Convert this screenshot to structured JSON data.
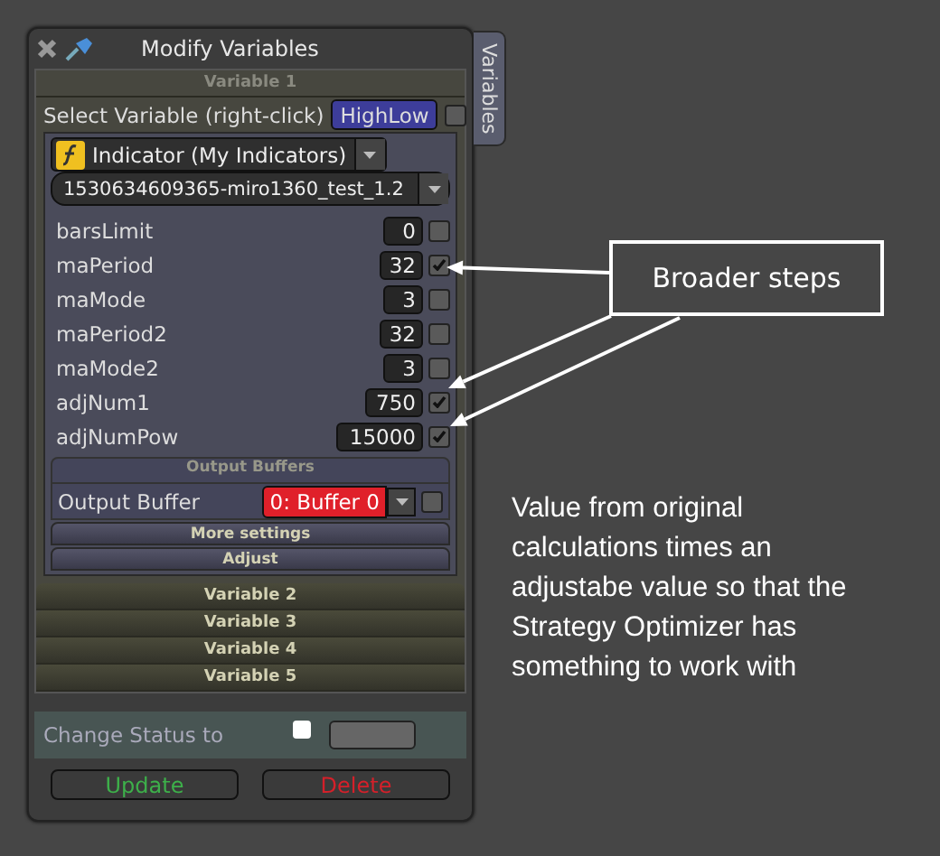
{
  "window": {
    "title": "Modify Variables",
    "side_tab": "Variables"
  },
  "sections": [
    {
      "title": "Variable 1",
      "expanded": true
    },
    {
      "title": "Variable 2",
      "expanded": false
    },
    {
      "title": "Variable 3",
      "expanded": false
    },
    {
      "title": "Variable 4",
      "expanded": false
    },
    {
      "title": "Variable 5",
      "expanded": false
    }
  ],
  "editor": {
    "select_label": "Select Variable (right-click)",
    "variable_button": "HighLow",
    "variable_checked": false,
    "indicator_dropdown": "Indicator (My Indicators)",
    "file_dropdown": "1530634609365-miro1360_test_1.2",
    "params": [
      {
        "name": "barsLimit",
        "value": "0",
        "checked": false
      },
      {
        "name": "maPeriod",
        "value": "32",
        "checked": true
      },
      {
        "name": "maMode",
        "value": "3",
        "checked": false
      },
      {
        "name": "maPeriod2",
        "value": "32",
        "checked": false
      },
      {
        "name": "maMode2",
        "value": "3",
        "checked": false
      },
      {
        "name": "adjNum1",
        "value": "750",
        "checked": true
      },
      {
        "name": "adjNumPow",
        "value": "15000",
        "checked": true
      }
    ],
    "output_buffers": {
      "title": "Output Buffers",
      "label": "Output Buffer",
      "value": "0: Buffer 0",
      "checked": false
    },
    "buttons": [
      "More settings",
      "Adjust"
    ]
  },
  "status": {
    "label": "Change Status to",
    "checked": false
  },
  "actions": [
    {
      "label": "Update",
      "kind": "update"
    },
    {
      "label": "Delete",
      "kind": "delete"
    }
  ],
  "annotations": {
    "callout": "Broader steps",
    "note": "Value from original\ncalculations times an\nadjustabe value so that the\nStrategy Optimizer has\nsomething to work with"
  }
}
